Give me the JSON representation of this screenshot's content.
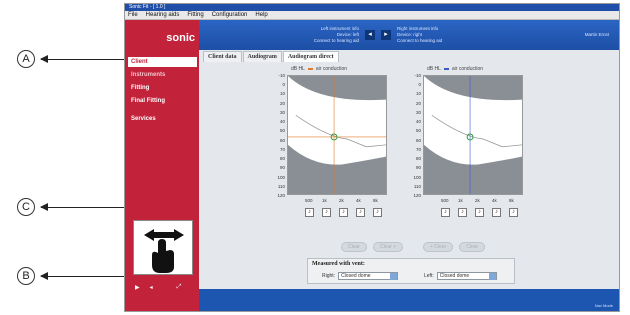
{
  "callouts": {
    "a": "A",
    "b": "B",
    "c": "C"
  },
  "window": {
    "title": "Sonic Fit - [ 1.0 ]",
    "menu": [
      "File",
      "Hearing aids",
      "Fitting",
      "Configuration",
      "Help"
    ]
  },
  "brand": {
    "logo": "sonic"
  },
  "sidebar": {
    "items": [
      {
        "label": "Client",
        "state": "active"
      },
      {
        "label": "Instruments",
        "state": "dim"
      },
      {
        "label": "Fitting",
        "state": "normal"
      },
      {
        "label": "Final Fitting",
        "state": "normal"
      },
      {
        "label": "Services",
        "state": "normal"
      }
    ]
  },
  "header": {
    "left_info": [
      "Left instrument info",
      "Device: left",
      "Connect to hearing aid"
    ],
    "right_info": [
      "Right instrument info",
      "Device: right",
      "Connect to hearing aid"
    ],
    "user": "Martin Ernst"
  },
  "tabs": [
    {
      "label": "Client data",
      "active": false
    },
    {
      "label": "Audiogram",
      "active": false
    },
    {
      "label": "Audiogram direct",
      "active": true
    }
  ],
  "audiograms": {
    "unit": "dB HL",
    "y_ticks": [
      "-10",
      "0",
      "10",
      "20",
      "30",
      "40",
      "50",
      "60",
      "70",
      "80",
      "90",
      "100",
      "110",
      "120"
    ],
    "x_ticks": [
      "500",
      "1k",
      "2k",
      "4k",
      "8k"
    ],
    "right": {
      "legend": "air conduction",
      "color": "#e07a2a"
    },
    "left": {
      "legend": "air conduction",
      "color": "#3a5bc7"
    }
  },
  "buttons": [
    "Clear",
    "Clear +",
    "+ Clear",
    "Clear"
  ],
  "vent": {
    "title": "Measured with vent:",
    "right_label": "Right:",
    "right_value": "Closed dome",
    "left_label": "Left:",
    "left_value": "Closed dome"
  },
  "status": {
    "text": "Nav Mode"
  }
}
